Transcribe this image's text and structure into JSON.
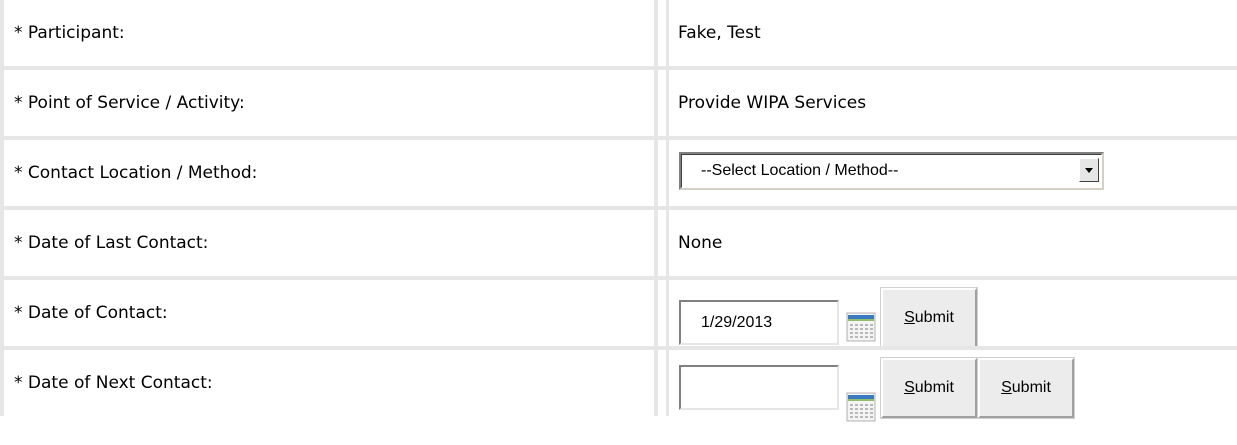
{
  "form": {
    "rows": [
      {
        "label": "* Participant:",
        "value": "Fake, Test"
      },
      {
        "label": "* Point of Service / Activity:",
        "value": "Provide WIPA Services"
      },
      {
        "label": "* Contact Location / Method:"
      },
      {
        "label": "* Date of Last Contact:",
        "value": "None"
      },
      {
        "label": "* Date of Contact:"
      },
      {
        "label": "* Date of Next Contact:"
      }
    ],
    "contact_location_select": {
      "selected": "--Select Location / Method--"
    },
    "date_of_contact": {
      "value": "1/29/2013",
      "submit_accesskey": "S",
      "submit_rest": "ubmit"
    },
    "date_of_next_contact": {
      "value": "",
      "submit_accesskey": "S",
      "submit_rest": "ubmit",
      "submit2_accesskey": "S",
      "submit2_rest": "ubmit"
    }
  },
  "icons": {
    "calendar": "calendar-icon",
    "dropdown": "chevron-down-icon"
  },
  "colors": {
    "grid": "#e6e6e6",
    "button_face": "#ececec"
  }
}
